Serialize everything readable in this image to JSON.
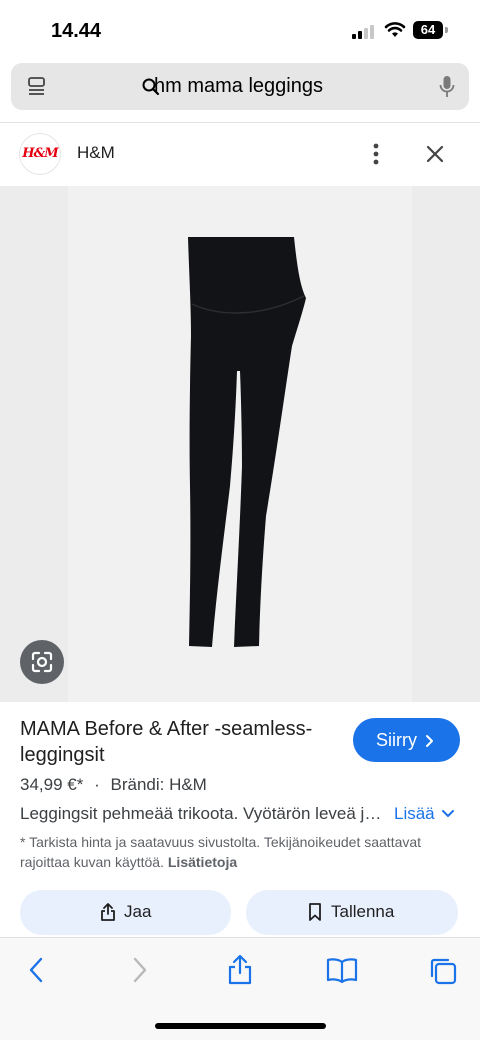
{
  "status": {
    "time": "14.44",
    "battery": "64"
  },
  "search": {
    "query": "hm mama leggings"
  },
  "source": {
    "logo_text": "H&M",
    "name": "H&M"
  },
  "product": {
    "title": "MAMA Before & After -seamless-leggingsit",
    "go_label": "Siirry",
    "price": "34,99 €*",
    "separator": "·",
    "brand": "Brändi: H&M",
    "description": "Leggingsit pehmeää trikoota. Vyötärön leveä joustava kaitale",
    "more_label": "Lisää",
    "note": "* Tarkista hinta ja saatavuus sivustolta. Tekijänoikeudet saattavat rajoittaa kuvan käyttöä.",
    "note_link": "Lisätietoja"
  },
  "actions": {
    "share_label": "Jaa",
    "save_label": "Tallenna"
  },
  "icons": [
    "tabs-icon",
    "search-icon",
    "microphone-icon",
    "more-vert-icon",
    "close-icon",
    "lens-icon",
    "chevron-right-icon",
    "chevron-down-icon",
    "share-icon",
    "bookmark-icon",
    "back-icon",
    "forward-icon",
    "book-icon",
    "tabs-overview-icon"
  ],
  "colors": {
    "accent": "#1a73e8",
    "pill_bg": "#e8f0fe",
    "hm_red": "#e50010",
    "search_bg": "#e6e6e6"
  }
}
